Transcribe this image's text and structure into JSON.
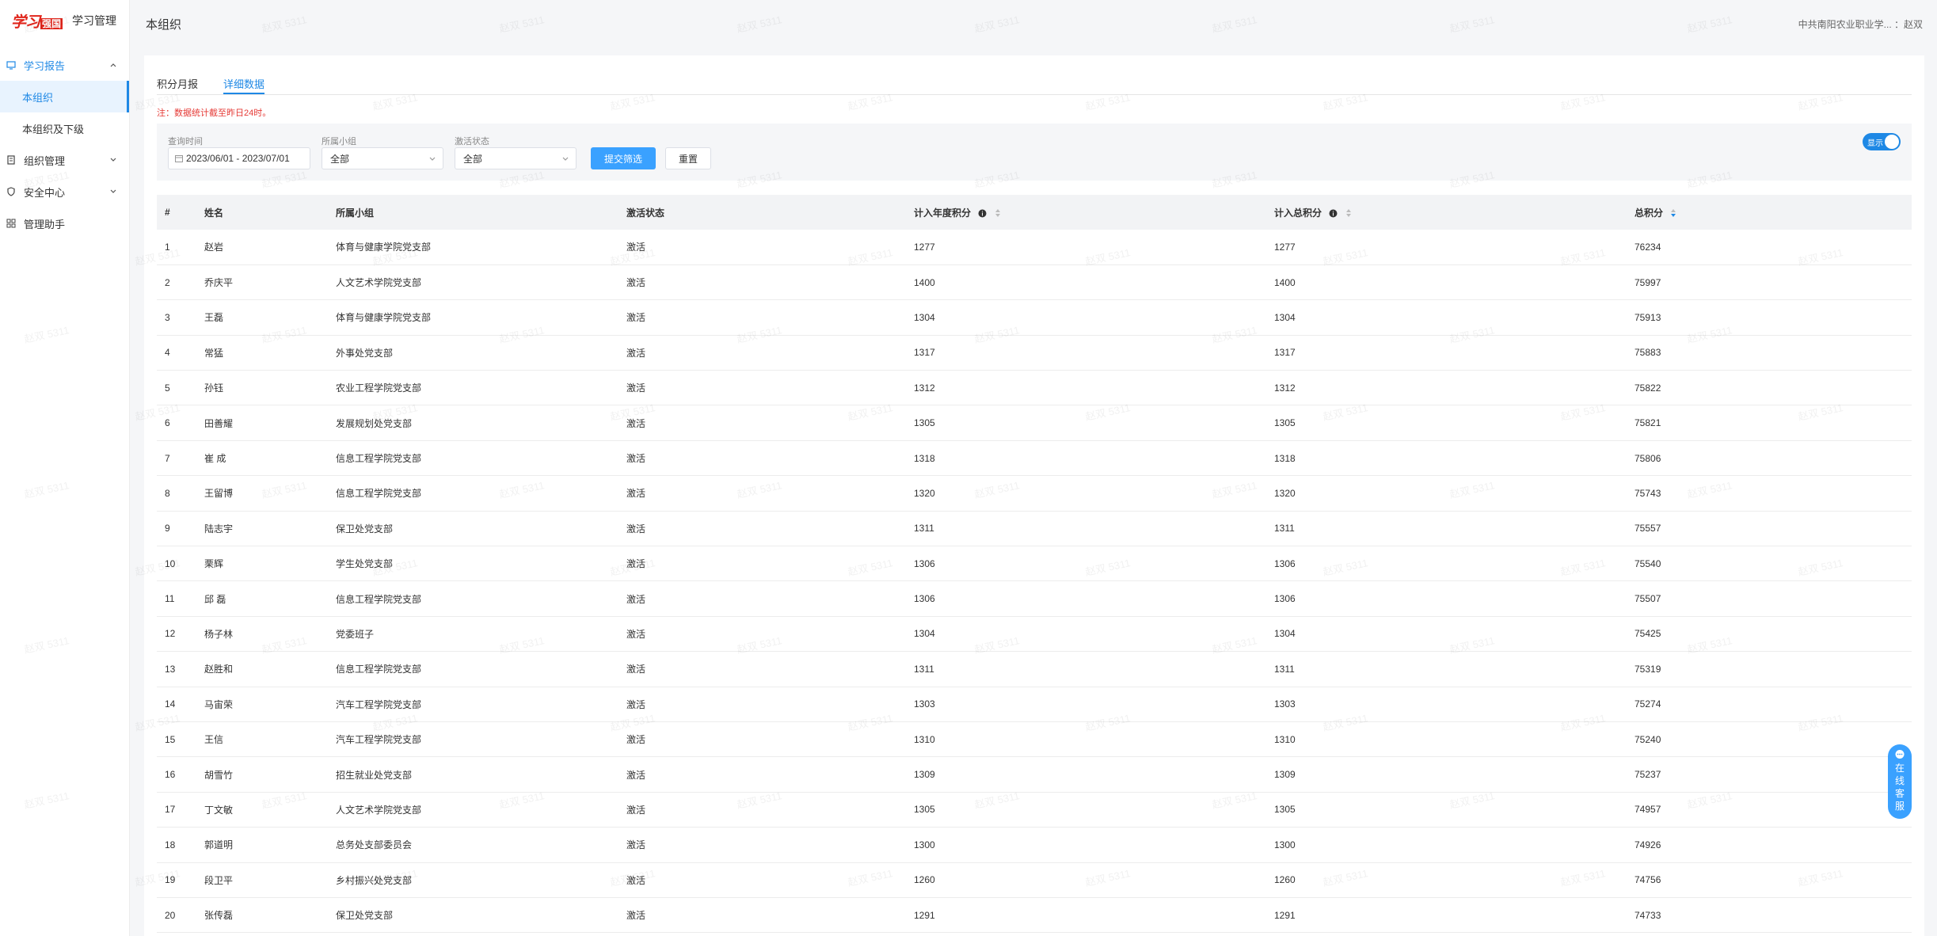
{
  "brand": {
    "logo": "学习强国",
    "title": "学习管理"
  },
  "sidebar": {
    "items": [
      {
        "label": "学习报告",
        "open": true,
        "children": [
          {
            "label": "本组织",
            "active": true
          },
          {
            "label": "本组织及下级",
            "active": false
          }
        ]
      },
      {
        "label": "组织管理"
      },
      {
        "label": "安全中心"
      },
      {
        "label": "管理助手"
      }
    ]
  },
  "header": {
    "title": "本组织",
    "user": "中共南阳农业职业学... ：赵双"
  },
  "tabs": [
    {
      "label": "积分月报",
      "active": false
    },
    {
      "label": "详细数据",
      "active": true
    }
  ],
  "note": "注：数据统计截至昨日24时。",
  "filters": {
    "date_label": "查询时间",
    "date_value": "2023/06/01 - 2023/07/01",
    "group_label": "所属小组",
    "group_value": "全部",
    "status_label": "激活状态",
    "status_value": "全部",
    "submit": "提交筛选",
    "reset": "重置",
    "toggle_label": "显示"
  },
  "table": {
    "headers": [
      "#",
      "姓名",
      "所属小组",
      "激活状态",
      "计入年度积分",
      "计入总积分",
      "总积分"
    ],
    "rows": [
      [
        "1",
        "赵岩",
        "体育与健康学院党支部",
        "激活",
        "1277",
        "1277",
        "76234"
      ],
      [
        "2",
        "乔庆平",
        "人文艺术学院党支部",
        "激活",
        "1400",
        "1400",
        "75997"
      ],
      [
        "3",
        "王磊",
        "体育与健康学院党支部",
        "激活",
        "1304",
        "1304",
        "75913"
      ],
      [
        "4",
        "常猛",
        "外事处党支部",
        "激活",
        "1317",
        "1317",
        "75883"
      ],
      [
        "5",
        "孙钰",
        "农业工程学院党支部",
        "激活",
        "1312",
        "1312",
        "75822"
      ],
      [
        "6",
        "田善耀",
        "发展规划处党支部",
        "激活",
        "1305",
        "1305",
        "75821"
      ],
      [
        "7",
        "崔 成",
        "信息工程学院党支部",
        "激活",
        "1318",
        "1318",
        "75806"
      ],
      [
        "8",
        "王留博",
        "信息工程学院党支部",
        "激活",
        "1320",
        "1320",
        "75743"
      ],
      [
        "9",
        "陆志宇",
        "保卫处党支部",
        "激活",
        "1311",
        "1311",
        "75557"
      ],
      [
        "10",
        "栗辉",
        "学生处党支部",
        "激活",
        "1306",
        "1306",
        "75540"
      ],
      [
        "11",
        "邱 磊",
        "信息工程学院党支部",
        "激活",
        "1306",
        "1306",
        "75507"
      ],
      [
        "12",
        "杨子林",
        "党委班子",
        "激活",
        "1304",
        "1304",
        "75425"
      ],
      [
        "13",
        "赵胜和",
        "信息工程学院党支部",
        "激活",
        "1311",
        "1311",
        "75319"
      ],
      [
        "14",
        "马宙荣",
        "汽车工程学院党支部",
        "激活",
        "1303",
        "1303",
        "75274"
      ],
      [
        "15",
        "王信",
        "汽车工程学院党支部",
        "激活",
        "1310",
        "1310",
        "75240"
      ],
      [
        "16",
        "胡雪竹",
        "招生就业处党支部",
        "激活",
        "1309",
        "1309",
        "75237"
      ],
      [
        "17",
        "丁文敏",
        "人文艺术学院党支部",
        "激活",
        "1305",
        "1305",
        "74957"
      ],
      [
        "18",
        "郭道明",
        "总务处支部委员会",
        "激活",
        "1300",
        "1300",
        "74926"
      ],
      [
        "19",
        "段卫平",
        "乡村振兴处党支部",
        "激活",
        "1260",
        "1260",
        "74756"
      ],
      [
        "20",
        "张传磊",
        "保卫处党支部",
        "激活",
        "1291",
        "1291",
        "74733"
      ]
    ]
  },
  "watermark": "赵双 5311",
  "service": [
    "在",
    "线",
    "客",
    "服"
  ],
  "colors": {
    "accent": "#1e88e5",
    "note": "#e53935",
    "button": "#3aa1ff"
  }
}
